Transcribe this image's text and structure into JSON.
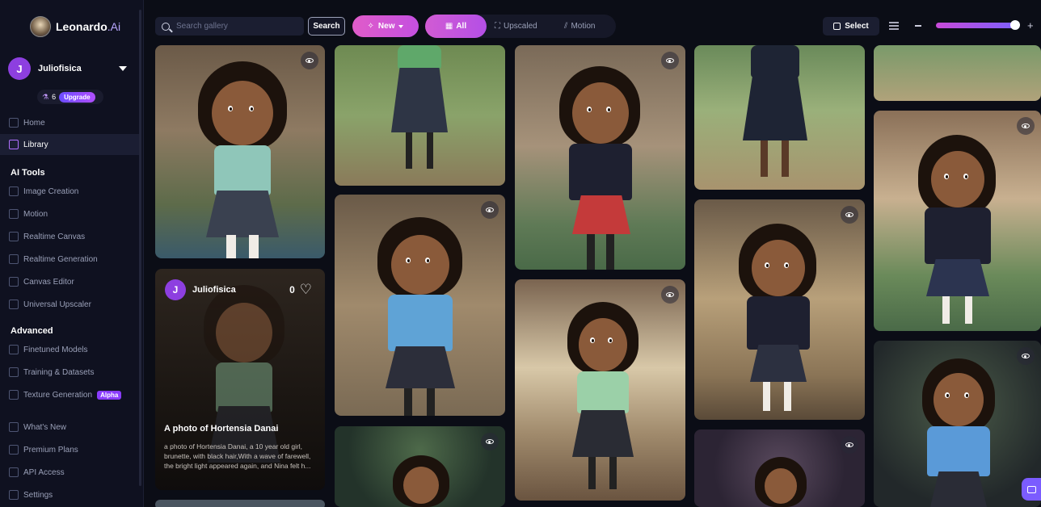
{
  "brand": {
    "name": "Leonardo",
    "suffix": ".Ai"
  },
  "user": {
    "initial": "J",
    "name": "Juliofisica",
    "tokens": "6",
    "upgrade_label": "Upgrade"
  },
  "nav": {
    "home": "Home",
    "library": "Library",
    "ai_tools_header": "AI Tools",
    "image_creation": "Image Creation",
    "motion": "Motion",
    "realtime_canvas": "Realtime Canvas",
    "realtime_generation": "Realtime Generation",
    "canvas_editor": "Canvas Editor",
    "universal_upscaler": "Universal Upscaler",
    "advanced_header": "Advanced",
    "finetuned_models": "Finetuned Models",
    "training_datasets": "Training & Datasets",
    "texture_generation": "Texture Generation",
    "alpha_badge": "Alpha",
    "whats_new": "What's New",
    "premium_plans": "Premium Plans",
    "api_access": "API Access",
    "settings": "Settings"
  },
  "toolbar": {
    "search_placeholder": "Search gallery",
    "search_button": "Search",
    "new_button": "New",
    "filters": {
      "all": "All",
      "upscaled": "Upscaled",
      "motion": "Motion"
    },
    "select_label": "Select",
    "zoom_level": 0.95
  },
  "overlay": {
    "author_initial": "J",
    "author": "Juliofisica",
    "likes": "0",
    "title": "A photo of Hortensia Danai",
    "description": "a photo of Hortensia Danai, a 10 year old girl, brunette, with black hair,With a wave of farewell, the bright light appeared again, and Nina felt h..."
  },
  "colors": {
    "accent": "#c44fe0",
    "sidebar_bg": "#0f1120",
    "page_bg": "#0b0d16"
  }
}
